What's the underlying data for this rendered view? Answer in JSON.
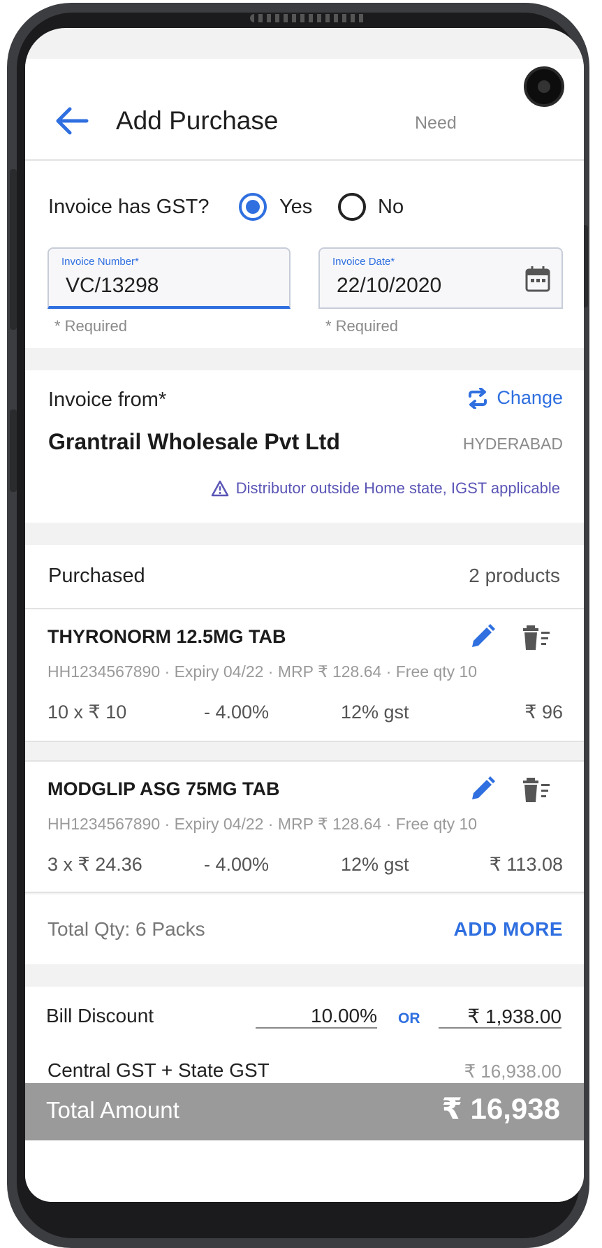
{
  "header": {
    "title": "Add Purchase",
    "need_text": "Need"
  },
  "gst": {
    "question": "Invoice has GST?",
    "yes_label": "Yes",
    "no_label": "No",
    "selected": "Yes"
  },
  "invoice_number": {
    "label": "Invoice Number*",
    "value": "VC/13298",
    "note": "* Required"
  },
  "invoice_date": {
    "label": "Invoice Date*",
    "value": "22/10/2020",
    "note": "* Required"
  },
  "invoice_from": {
    "label": "Invoice from*",
    "change_label": "Change",
    "distributor_name": "Grantrail Wholesale Pvt Ltd",
    "city": "HYDERABAD",
    "warning": "Distributor outside Home state, IGST applicable"
  },
  "purchased": {
    "label": "Purchased",
    "count": "2 products",
    "items": [
      {
        "name": "THYRONORM 12.5MG TAB",
        "meta": "HH1234567890 · Expiry 04/22 · MRP ₹ 128.64 · Free qty 10",
        "qty_price": "10 x  ₹ 10",
        "discount": "- 4.00%",
        "gst": "12% gst",
        "amount": "₹ 96"
      },
      {
        "name": "MODGLIP ASG 75MG TAB",
        "meta": "HH1234567890 · Expiry 04/22 · MRP ₹ 128.64 · Free qty 10",
        "qty_price": "3 x  ₹ 24.36",
        "discount": "- 4.00%",
        "gst": "12% gst",
        "amount": "₹ 113.08"
      }
    ]
  },
  "totals": {
    "total_qty": "Total Qty: 6 Packs",
    "add_more": "ADD MORE",
    "bill_discount_label": "Bill Discount",
    "bill_discount_pct": "10.00%",
    "or_label": "OR",
    "bill_discount_amt": "₹ 1,938.00",
    "gst_label": "Central GST + State GST",
    "gst_amt": "₹ 16,938.00",
    "total_label": "Total Amount",
    "total_value": "₹ 16,938"
  },
  "colors": {
    "accent": "#2f6fe0",
    "warning": "#5a55b5",
    "total_bar": "#9a9a9a"
  },
  "icons": [
    "back-arrow-icon",
    "calendar-icon",
    "swap-icon",
    "warning-icon",
    "edit-icon",
    "delete-icon"
  ]
}
